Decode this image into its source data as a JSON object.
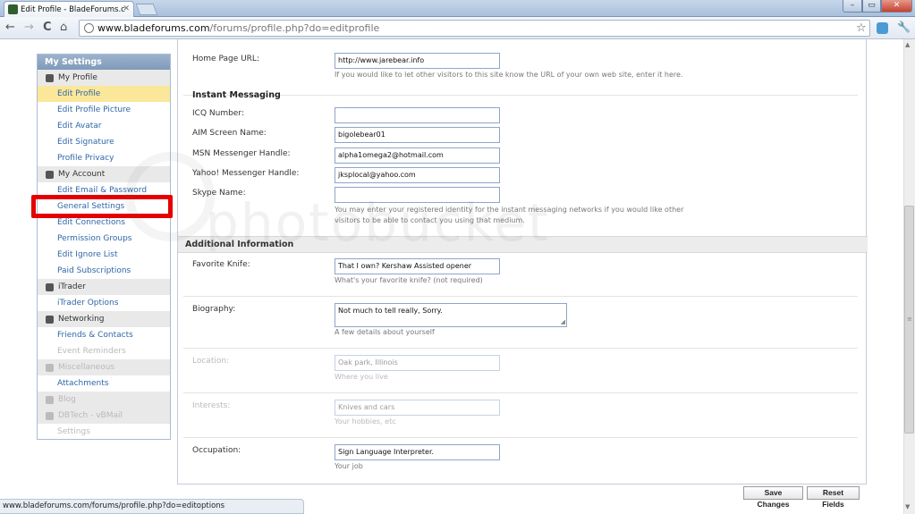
{
  "browser": {
    "tab_title": "Edit Profile - BladeForums.c",
    "tab_close": "✕",
    "window_buttons": {
      "min": "–",
      "max": "▭",
      "close": "✕"
    },
    "nav": {
      "back": "←",
      "forward": "→",
      "reload": "C",
      "home": "⌂"
    },
    "url_host": "www.bladeforums.com",
    "url_path": "/forums/profile.php?do=editprofile",
    "star": "☆",
    "wrench": "🔧",
    "status_url": "www.bladeforums.com/forums/profile.php?do=editoptions"
  },
  "sidebar": {
    "header": "My Settings",
    "groups": [
      {
        "label": "My Profile",
        "icon": "user-icon",
        "dim": false,
        "items": [
          {
            "label": "Edit Profile",
            "active": true,
            "dim": false
          },
          {
            "label": "Edit Profile Picture",
            "active": false,
            "dim": false
          },
          {
            "label": "Edit Avatar",
            "active": false,
            "dim": false
          },
          {
            "label": "Edit Signature",
            "active": false,
            "dim": false
          },
          {
            "label": "Profile Privacy",
            "active": false,
            "dim": false
          }
        ]
      },
      {
        "label": "My Account",
        "icon": "lock-icon",
        "dim": false,
        "items": [
          {
            "label": "Edit Email & Password",
            "active": false,
            "dim": false
          },
          {
            "label": "General Settings",
            "active": false,
            "dim": false
          },
          {
            "label": "Edit Connections",
            "active": false,
            "dim": false
          },
          {
            "label": "Permission Groups",
            "active": false,
            "dim": false
          },
          {
            "label": "Edit Ignore List",
            "active": false,
            "dim": false
          },
          {
            "label": "Paid Subscriptions",
            "active": false,
            "dim": false
          }
        ]
      },
      {
        "label": "iTrader",
        "icon": "itrader-icon",
        "dim": false,
        "items": [
          {
            "label": "iTrader Options",
            "active": false,
            "dim": false
          }
        ]
      },
      {
        "label": "Networking",
        "icon": "people-icon",
        "dim": false,
        "items": [
          {
            "label": "Friends & Contacts",
            "active": false,
            "dim": false
          },
          {
            "label": "Event Reminders",
            "active": false,
            "dim": true
          }
        ]
      },
      {
        "label": "Miscellaneous",
        "icon": "misc-icon",
        "dim": true,
        "items": [
          {
            "label": "Attachments",
            "active": false,
            "dim": false
          }
        ]
      },
      {
        "label": "Blog",
        "icon": "blog-icon",
        "dim": true,
        "items": []
      },
      {
        "label": "DBTech - vBMail",
        "icon": "mail-icon",
        "dim": true,
        "items": [
          {
            "label": "Settings",
            "active": false,
            "dim": true
          }
        ]
      }
    ]
  },
  "form": {
    "homepage": {
      "label": "Home Page URL:",
      "value": "http://www.jarebear.info",
      "hint": "If you would like to let other visitors to this site know the URL of your own web site, enter it here."
    },
    "im_heading": "Instant Messaging",
    "icq": {
      "label": "ICQ Number:",
      "value": ""
    },
    "aim": {
      "label": "AIM Screen Name:",
      "value": "bigolebear01"
    },
    "msn": {
      "label": "MSN Messenger Handle:",
      "value": "alpha1omega2@hotmail.com"
    },
    "yahoo": {
      "label": "Yahoo! Messenger Handle:",
      "value": "jksplocal@yahoo.com"
    },
    "skype": {
      "label": "Skype Name:",
      "value": ""
    },
    "im_hint_1": "You may enter your registered identity for the instant messaging networks if you would like other",
    "im_hint_2": "visitors to be able to contact you using that medium.",
    "additional_heading": "Additional Information",
    "knife": {
      "label": "Favorite Knife:",
      "value": "That I own? Kershaw Assisted opener",
      "hint": "What's your favorite knife? (not required)"
    },
    "bio": {
      "label": "Biography:",
      "value": "Not much to tell really, Sorry.",
      "hint": "A few details about yourself"
    },
    "location": {
      "label": "Location:",
      "value": "Oak park, Illinois",
      "hint": "Where you live"
    },
    "interests": {
      "label": "Interests:",
      "value": "Knives and cars",
      "hint": "Your hobbies, etc"
    },
    "occupation": {
      "label": "Occupation:",
      "value": "Sign Language Interpreter.",
      "hint": "Your job"
    },
    "save_label": "Save Changes",
    "reset_label": "Reset Fields"
  },
  "watermark": "photobucket"
}
